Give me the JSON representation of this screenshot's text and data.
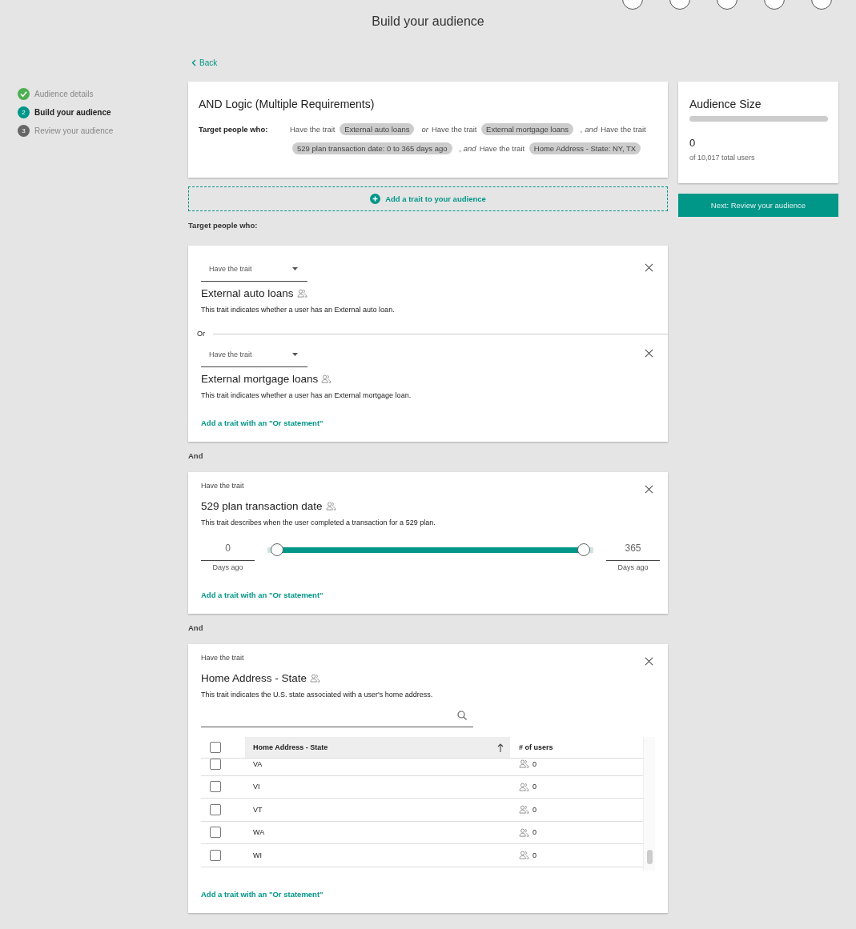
{
  "title": "Build your audience",
  "back": "Back",
  "steps": [
    {
      "label": "Audience details",
      "completed": true,
      "selected": false
    },
    {
      "number": "2",
      "label": "Build your audience",
      "completed": false,
      "selected": true
    },
    {
      "number": "3",
      "label": "Review your audience",
      "completed": false,
      "selected": false
    }
  ],
  "summary": {
    "title": "AND Logic (Multiple Requirements)",
    "label": "Target people who:",
    "parts": [
      {
        "kind": "text",
        "text": "Have the trait"
      },
      {
        "kind": "chip",
        "text": "External auto loans"
      },
      {
        "kind": "conj",
        "text": "or"
      },
      {
        "kind": "text",
        "text": "Have the trait"
      },
      {
        "kind": "chip",
        "text": "External mortgage loans"
      },
      {
        "kind": "conj",
        "text": ", and"
      },
      {
        "kind": "text",
        "text": "Have the trait"
      },
      {
        "kind": "chip",
        "text": "529 plan transaction date: 0 to 365 days ago"
      },
      {
        "kind": "conj",
        "text": ", and"
      },
      {
        "kind": "text",
        "text": "Have the trait"
      },
      {
        "kind": "chip",
        "text": "Home Address - State: NY, TX"
      }
    ]
  },
  "add_trait": "Add a trait to your audience",
  "target_label": "Target people who:",
  "blocks": [
    {
      "kind": "group",
      "or_link": "Add a trait with an \"Or statement\"",
      "conditions": [
        {
          "kind": "select",
          "operator": "Have the trait",
          "name": "External auto loans",
          "description": "This trait indicates whether a user has an External auto loan."
        },
        {
          "kind": "or",
          "text": "Or"
        },
        {
          "kind": "select",
          "operator": "Have the trait",
          "name": "External mortgage loans",
          "description": "This trait indicates whether a user has an External mortgage loan."
        }
      ]
    },
    {
      "kind": "connector",
      "text": "And"
    },
    {
      "kind": "group",
      "or_link": "Add a trait with an \"Or statement\"",
      "conditions": [
        {
          "kind": "range",
          "operator": "Have the trait",
          "name": "529 plan transaction date",
          "description": "This trait describes when the user completed a transaction for a 529 plan.",
          "min": "0",
          "max": "365",
          "min_caption": "Days ago",
          "max_caption": "Days ago",
          "thumbs": [
            {
              "level": 0
            },
            {
              "level": 1
            }
          ]
        }
      ]
    },
    {
      "kind": "connector",
      "text": "And"
    },
    {
      "kind": "group",
      "or_link": "Add a trait with an \"Or statement\"",
      "conditions": [
        {
          "kind": "table",
          "operator": "Have the trait",
          "name": "Home Address - State",
          "description": "This trait indicates the U.S. state associated with a user's home address.",
          "header_checked": false,
          "columns": [
            "Home Address - State",
            "# of users"
          ],
          "rows": [
            {
              "state": "VA",
              "users": "0",
              "checked": false
            },
            {
              "state": "VI",
              "users": "0",
              "checked": false
            },
            {
              "state": "VT",
              "users": "0",
              "checked": false
            },
            {
              "state": "WA",
              "users": "0",
              "checked": false
            },
            {
              "state": "WI",
              "users": "0",
              "checked": false
            }
          ]
        }
      ]
    }
  ],
  "audience": {
    "title": "Audience Size",
    "level": 0,
    "count": "0",
    "caption": "of 10,017 total users"
  },
  "next": "Next: Review your audience"
}
